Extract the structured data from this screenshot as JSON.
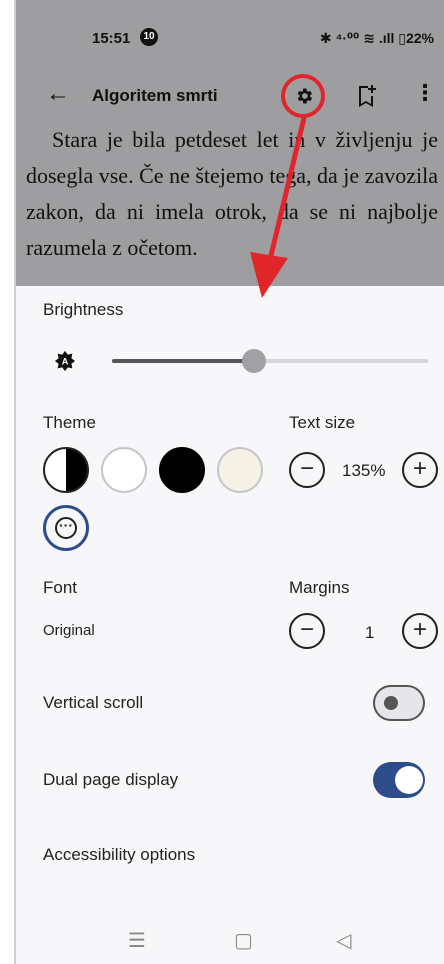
{
  "status_bar": {
    "time": "15:51",
    "notification_count": "10",
    "right_icons": "✱ ⁴·⁰⁰ ≋ .ıll ▯22%"
  },
  "toolbar": {
    "title": "Algoritem smrti"
  },
  "book_text": "Stara je bila petdeset let in v življenju je dosegla vse. Če ne štejemo tega, da je zavozila zakon, da ni imela otrok, da se ni najbolje razumela z očetom.",
  "settings": {
    "brightness_label": "Brightness",
    "brightness_value": 0.45,
    "theme_label": "Theme",
    "text_size_label": "Text size",
    "text_size_value": "135%",
    "font_label": "Font",
    "font_value": "Original",
    "margins_label": "Margins",
    "margins_value": "1",
    "vertical_scroll_label": "Vertical scroll",
    "vertical_scroll_on": false,
    "dual_page_label": "Dual page display",
    "dual_page_on": true,
    "accessibility_label": "Accessibility options"
  },
  "themes": [
    "contrast",
    "white",
    "black",
    "sepia",
    "more"
  ],
  "colors": {
    "accent": "#2d4c8a",
    "annotation": "#e0262b",
    "sepia": "#f5f2e5"
  }
}
